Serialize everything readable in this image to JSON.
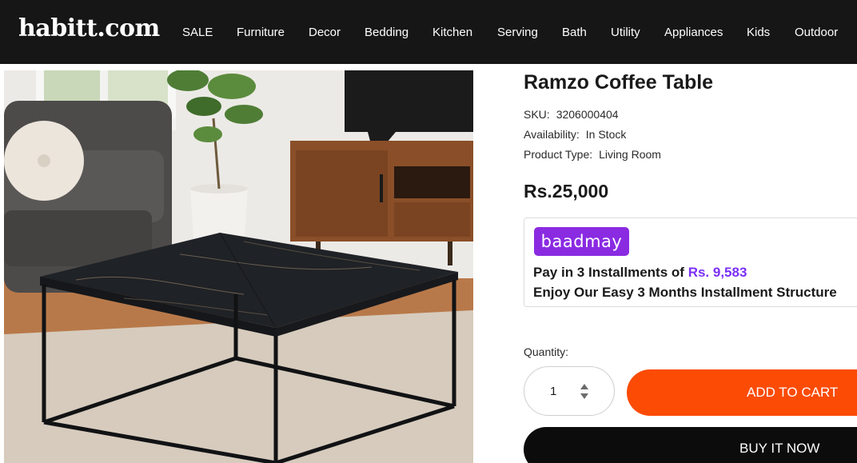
{
  "header": {
    "logo": "habitt.com",
    "nav": [
      {
        "label": "SALE",
        "key": "sale"
      },
      {
        "label": "Furniture",
        "key": "furniture"
      },
      {
        "label": "Decor",
        "key": "decor"
      },
      {
        "label": "Bedding",
        "key": "bedding"
      },
      {
        "label": "Kitchen",
        "key": "kitchen"
      },
      {
        "label": "Serving",
        "key": "serving"
      },
      {
        "label": "Bath",
        "key": "bath"
      },
      {
        "label": "Utility",
        "key": "utility"
      },
      {
        "label": "Appliances",
        "key": "appliances"
      },
      {
        "label": "Kids",
        "key": "kids"
      },
      {
        "label": "Outdoor",
        "key": "outdoor"
      }
    ]
  },
  "product": {
    "title": "Ramzo Coffee Table",
    "sku_label": "SKU:",
    "sku": "3206000404",
    "availability_label": "Availability:",
    "availability": "In Stock",
    "type_label": "Product Type:",
    "type": "Living Room",
    "price": "Rs.25,000"
  },
  "bnpl": {
    "logo": "baadmay",
    "line1_prefix": "Pay in 3 Installments of",
    "amount": "Rs. 9,583",
    "line2": "Enjoy Our Easy 3 Months Installment Structure"
  },
  "purchase": {
    "quantity_label": "Quantity:",
    "quantity": "1",
    "add_to_cart": "ADD TO CART",
    "buy_now": "BUY IT NOW"
  },
  "colors": {
    "header_bg": "#161616",
    "add_to_cart": "#fb4b05",
    "buy_now": "#0c0c0c",
    "bnpl_brand": "#8a2be2",
    "bnpl_amount": "#7b2ff7"
  },
  "icons": [
    "stepper-up-icon",
    "stepper-down-icon"
  ]
}
